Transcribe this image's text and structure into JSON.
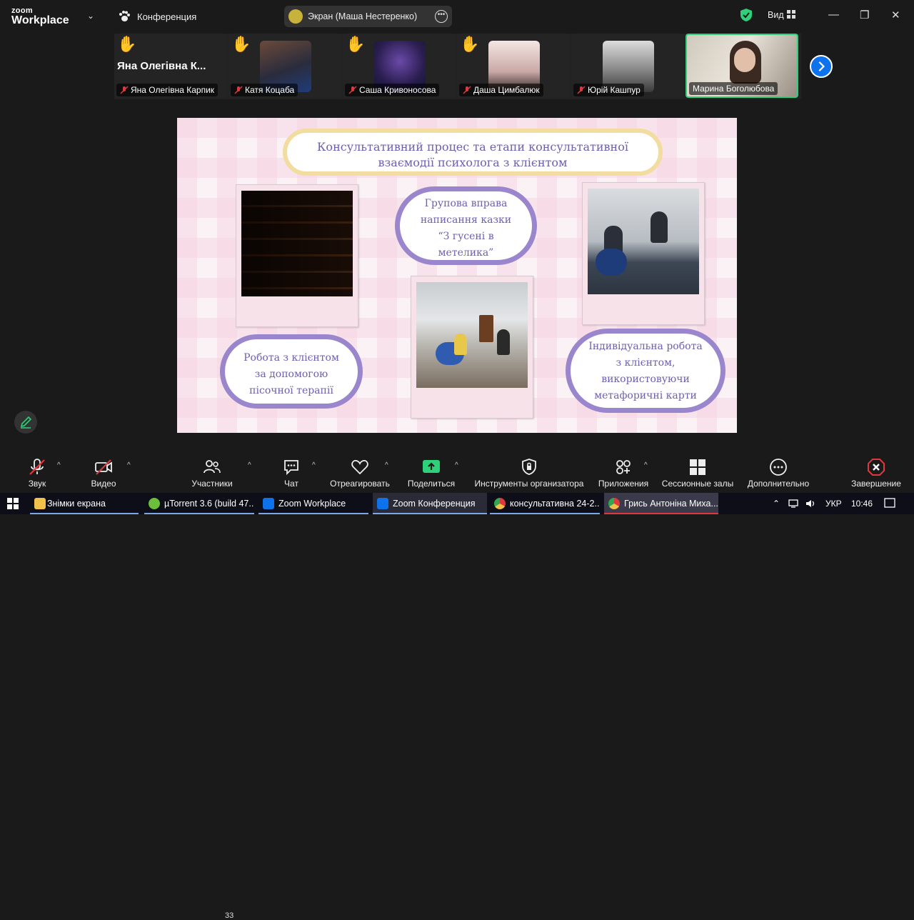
{
  "app": {
    "logo_small": "zoom",
    "logo_big": "Workplace",
    "conference_label": "Конференция",
    "screen_share_label": "Экран (Маша Нестеренко)",
    "view_label": "Вид",
    "accent": "#0e72ed",
    "security_color": "#2fd07a"
  },
  "participants": {
    "raised_hand_name": "Яна  Олегівна  К...",
    "tiles": [
      {
        "name": "Яна Олегівна Карпик",
        "hand": true,
        "muted": true
      },
      {
        "name": "Катя Коцаба",
        "hand": true,
        "muted": true
      },
      {
        "name": "Саша Кривоносова",
        "hand": true,
        "muted": true
      },
      {
        "name": "Даша Цимбалюк",
        "hand": true,
        "muted": true
      },
      {
        "name": "Юрій Кашпур",
        "hand": false,
        "muted": true
      },
      {
        "name": "Марина Боголюбова",
        "hand": false,
        "muted": false,
        "active": true
      }
    ]
  },
  "slide": {
    "title_line1": "Консультативний процес та етапи консультативної",
    "title_line2": "взаємодії психолога з клієнтом",
    "pill_top_lines": [
      "Групова вправа",
      "написання казки",
      "“З гусені в",
      "метелика”"
    ],
    "pill_left_lines": [
      "Робота з клієнтом",
      "за допомогою",
      "пісочної терапії"
    ],
    "pill_right_lines": [
      "Індивідуальна робота",
      "з клієнтом,",
      "використовуючи",
      "метафоричні карти"
    ]
  },
  "toolbar": {
    "audio": "Звук",
    "video": "Видео",
    "participants": "Участники",
    "participants_count": "33",
    "chat": "Чат",
    "react": "Отреагировать",
    "share": "Поделиться",
    "host_tools": "Инструменты организатора",
    "apps": "Приложения",
    "breakout": "Сессионные залы",
    "more": "Дополнительно",
    "end": "Завершение",
    "share_color": "#2fd07a",
    "end_color": "#e0383e"
  },
  "taskbar": {
    "tasks": [
      {
        "label": "Знімки екрана"
      },
      {
        "label": "µTorrent 3.6  (build 47..."
      },
      {
        "label": "Zoom Workplace"
      },
      {
        "label": "Zoom Конференция"
      },
      {
        "label": "консультативна 24-2..."
      },
      {
        "label": "Грись Антоніна Миха..."
      }
    ],
    "lang": "УКР",
    "time": "10:46"
  }
}
